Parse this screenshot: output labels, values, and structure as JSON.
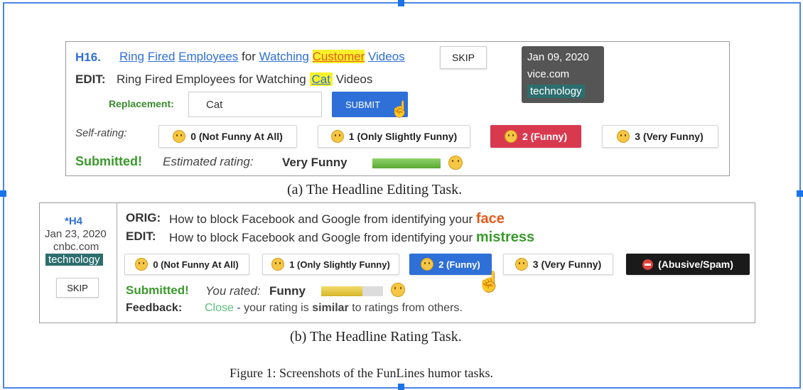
{
  "panel_a": {
    "headline_id": "H16.",
    "headline_words": [
      "Ring",
      "Fired",
      "Employees",
      "for",
      "Watching",
      "Customer",
      "Videos"
    ],
    "skip_label": "SKIP",
    "date": "Jan 09, 2020",
    "source": "vice.com",
    "category": "technology",
    "edit_label": "EDIT:",
    "edit_prefix": "Ring Fired Employees for Watching",
    "edit_word": "Cat",
    "edit_suffix": "Videos",
    "replacement_label": "Replacement:",
    "replacement_value": "Cat",
    "submit_label": "SUBMIT",
    "self_rating_label": "Self-rating:",
    "ratings": [
      "0 (Not Funny At All)",
      "1 (Only Slightly Funny)",
      "2 (Funny)",
      "3 (Very Funny)"
    ],
    "submitted_label": "Submitted!",
    "estimated_label": "Estimated rating:",
    "estimated_value": "Very Funny",
    "estimated_fraction": 1.0
  },
  "panel_a_caption": "(a) The Headline Editing Task.",
  "panel_b": {
    "headline_id": "*H4",
    "date": "Jan 23, 2020",
    "source": "cnbc.com",
    "category": "technology",
    "skip_label": "SKIP",
    "orig_label": "ORIG:",
    "orig_text": "How to block Facebook and Google from identifying your",
    "orig_word": "face",
    "edit_label": "EDIT:",
    "edit_text": "How to block Facebook and Google from identifying your",
    "edit_word": "mistress",
    "ratings": [
      "0 (Not Funny At All)",
      "1 (Only Slightly Funny)",
      "2 (Funny)",
      "3 (Very Funny)",
      "(Abusive/Spam)"
    ],
    "submitted_label": "Submitted!",
    "rated_label": "You rated:",
    "rated_value": "Funny",
    "rated_fraction": 0.67,
    "feedback_label": "Feedback:",
    "feedback_close": "Close",
    "feedback_mid": "- your rating is",
    "feedback_bold": "similar",
    "feedback_end": "to ratings from others."
  },
  "panel_b_caption": "(b) The Headline Rating Task.",
  "figure_caption": "Figure 1: Screenshots of the FunLines humor tasks.",
  "colors": {
    "accent_blue": "#2f6fd6",
    "submit_blue": "#2e6fd8",
    "funny_red": "#d9394e",
    "green": "#3a9a2c",
    "orange_word": "#e55a1b",
    "tag_teal": "#2d6e6e",
    "abusive_black": "#1a1a1a"
  }
}
